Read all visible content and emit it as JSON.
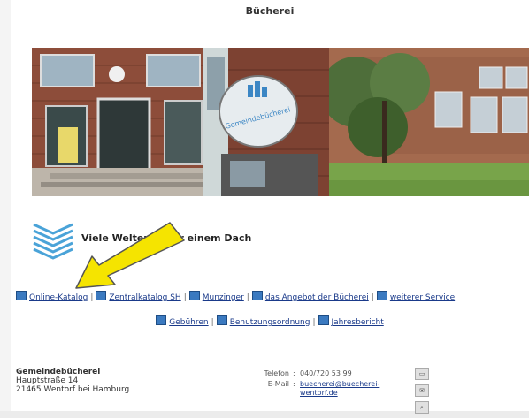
{
  "header": {
    "title": "Bücherei"
  },
  "branding": {
    "slogan": "Viele Welten unter einem Dach",
    "sign_text": "Gemeindebücherei"
  },
  "nav_primary": [
    {
      "label": "Online-Katalog"
    },
    {
      "label": "Zentralkatalog SH"
    },
    {
      "label": "Munzinger"
    },
    {
      "label": "das Angebot der Bücherei"
    },
    {
      "label": "weiterer Service"
    }
  ],
  "nav_secondary": [
    {
      "label": "Gebühren"
    },
    {
      "label": "Benutzungsordnung"
    },
    {
      "label": "Jahresbericht"
    }
  ],
  "footer": {
    "name": "Gemeindebücherei",
    "street": "Hauptstraße 14",
    "city": "21465 Wentorf bei Hamburg",
    "phone_label": "Telefon",
    "phone": "040/720 53 99",
    "email_label": "E-Mail",
    "email": "buecherei@buecherei-wentorf.de"
  },
  "colors": {
    "link": "#1a3a8a",
    "nav_icon": "#3b7ac0",
    "arrow": "#f5e400"
  }
}
